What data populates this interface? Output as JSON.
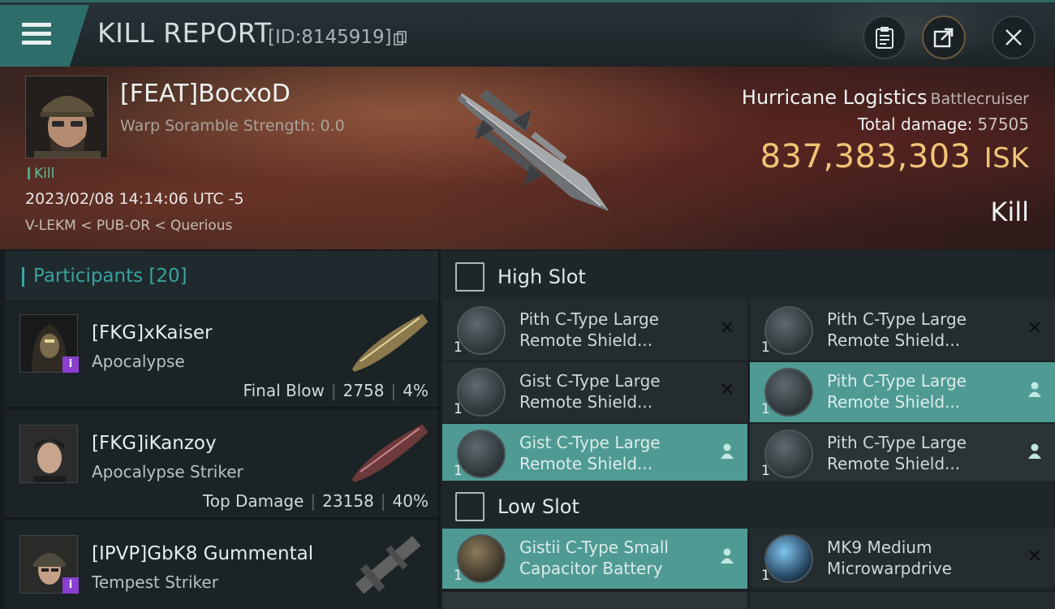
{
  "header": {
    "title": "KILL REPORT",
    "report_id": "[ID:8145919]"
  },
  "victim": {
    "name": "[FEAT]BocxoD",
    "scramble": "Warp Soramble Strength: 0.0",
    "tag": "Kill",
    "datetime": "2023/02/08 14:14:06 UTC -5",
    "location": "V-LEKM < PUB-OR < Querious",
    "ship_name": "Hurricane Logistics",
    "ship_class": "Battlecruiser",
    "total_damage_label": "Total damage:",
    "total_damage": "57505",
    "isk_value": "837,383,303",
    "isk_unit": "ISK",
    "result": "Kill"
  },
  "participants": {
    "title": "Participants",
    "count": "[20]",
    "rows": [
      {
        "name": "[FKG]xKaiser",
        "ship": "Apocalypse",
        "role": "Final Blow",
        "damage": "2758",
        "percent": "4%",
        "badge": "i"
      },
      {
        "name": "[FKG]iKanzoy",
        "ship": "Apocalypse Striker",
        "role": "Top Damage",
        "damage": "23158",
        "percent": "40%",
        "badge": ""
      },
      {
        "name": "[IPVP]GbK8 Gummental",
        "ship": "Tempest Striker",
        "role": "",
        "damage": "",
        "percent": "",
        "badge": "i"
      }
    ]
  },
  "fittings": {
    "high_slot_title": "High Slot",
    "low_slot_title": "Low Slot",
    "high": [
      {
        "line1": "Pith C-Type Large",
        "line2": "Remote Shield...",
        "qty": "1",
        "state": "destroyed",
        "active": false
      },
      {
        "line1": "Pith C-Type Large",
        "line2": "Remote Shield...",
        "qty": "1",
        "state": "destroyed",
        "active": false
      },
      {
        "line1": "Gist C-Type Large",
        "line2": "Remote Shield...",
        "qty": "1",
        "state": "destroyed",
        "active": false
      },
      {
        "line1": "Pith C-Type Large",
        "line2": "Remote Shield...",
        "qty": "1",
        "state": "dropped",
        "active": true
      },
      {
        "line1": "Gist C-Type Large",
        "line2": "Remote Shield...",
        "qty": "1",
        "state": "dropped",
        "active": true
      },
      {
        "line1": "Pith C-Type Large",
        "line2": "Remote Shield...",
        "qty": "1",
        "state": "dropped",
        "active": false
      }
    ],
    "low": [
      {
        "line1": "Gistii C-Type Small",
        "line2": "Capacitor Battery",
        "qty": "1",
        "state": "dropped",
        "active": true
      },
      {
        "line1": "MK9 Medium",
        "line2": "Microwarpdrive",
        "qty": "1",
        "state": "destroyed",
        "active": false
      }
    ]
  },
  "colors": {
    "accent_teal": "#3aa7a0",
    "isk_gold": "#f0c476",
    "active_module": "#4f9b94",
    "badge_purple": "#8a3fd0"
  }
}
